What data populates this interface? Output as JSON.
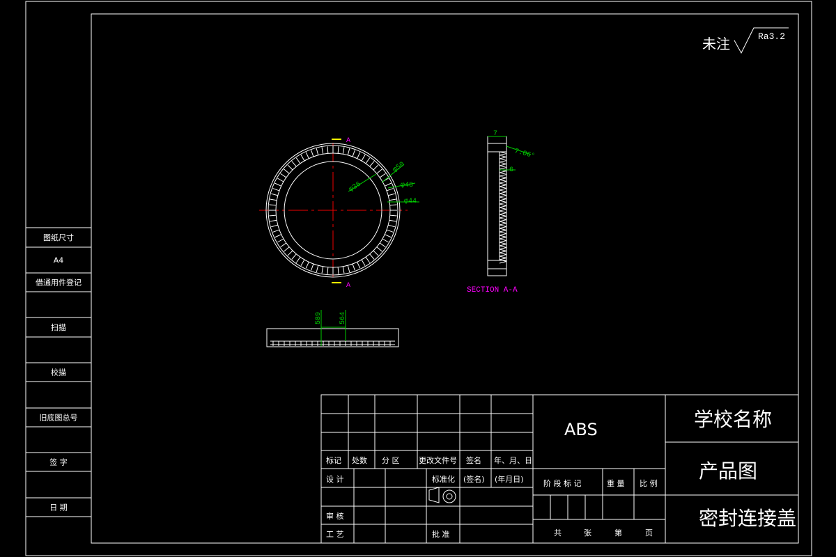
{
  "roughness": {
    "note": "未注",
    "value": "Ra3.2"
  },
  "drawing": {
    "section_marker": "A",
    "section_label": "SECTION A-A",
    "front_dims": {
      "d50": "φ50",
      "d48": "φ48",
      "d44": "φ44",
      "d36": "φ36"
    },
    "section_dims": {
      "width": "7",
      "tooth": "6",
      "angle": "7.06°"
    },
    "bottom_dims": {
      "a": "589",
      "b": "564"
    }
  },
  "left_column": {
    "items": [
      {
        "label": "图纸尺寸"
      },
      {
        "label": "A4"
      },
      {
        "label": "借通用件登记"
      },
      {
        "label": ""
      },
      {
        "label": "扫描"
      },
      {
        "label": ""
      },
      {
        "label": "校描"
      },
      {
        "label": ""
      },
      {
        "label": "旧底图总号"
      },
      {
        "label": ""
      },
      {
        "label": "签  字"
      },
      {
        "label": ""
      },
      {
        "label": "日  期"
      }
    ]
  },
  "title_block": {
    "headers": [
      "标记",
      "处数",
      "分 区",
      "更改文件号",
      "签名",
      "年、月、日"
    ],
    "design": "设  计",
    "standardize": "标准化",
    "sign": "(签名)",
    "date": "(年月日)",
    "review": "审  核",
    "process": "工  艺",
    "approve": "批  准",
    "material": "ABS",
    "stage_labels": {
      "stage": "阶 段 标 记",
      "weight": "重 量",
      "scale": "比 例"
    },
    "sheet": {
      "total": "共",
      "unit": "张",
      "nth": "第",
      "page": "页"
    },
    "school": "学校名称",
    "drawing_type": "产品图",
    "part_name": "密封连接盖"
  }
}
